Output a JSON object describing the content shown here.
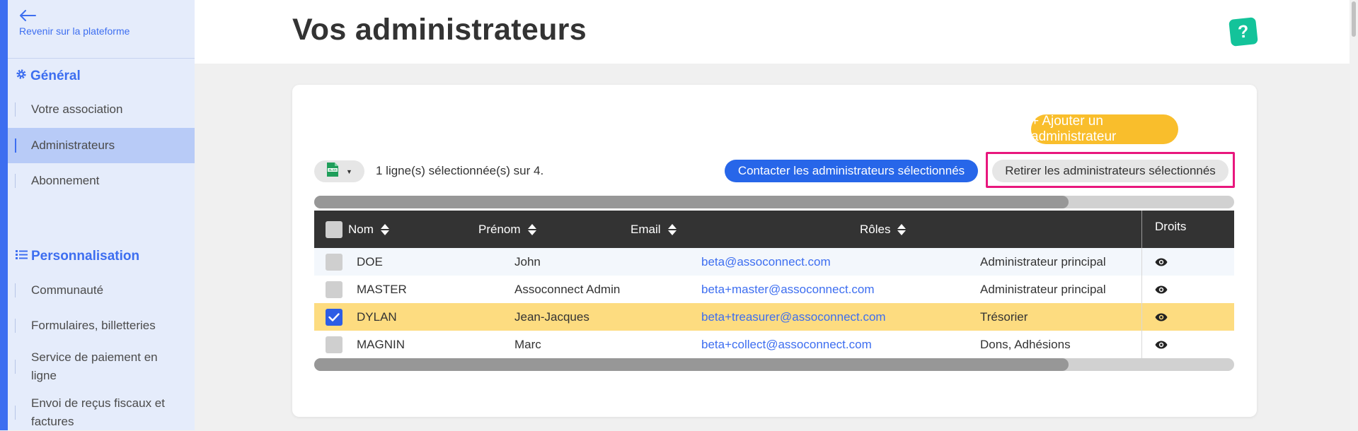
{
  "sidebar": {
    "back_label": "Revenir sur la plateforme",
    "general_title": "Général",
    "general_items": [
      "Votre association",
      "Administrateurs",
      "Abonnement"
    ],
    "active_item": "Administrateurs",
    "perso_title": "Personnalisation",
    "perso_items": [
      "Communauté",
      "Formulaires, billetteries",
      "Service de paiement en ligne",
      "Envoi de reçus fiscaux et factures"
    ]
  },
  "page": {
    "title": "Vos administrateurs",
    "help_label": "?"
  },
  "toolbar": {
    "add_button": "+ Ajouter un administrateur",
    "selection_text": "1 ligne(s) sélectionnée(s) sur 4.",
    "contact_button": "Contacter les administrateurs sélectionnés",
    "remove_button": "Retirer les administrateurs sélectionnés",
    "export_icon": "xlsx-file-icon"
  },
  "table": {
    "headers": {
      "nom": "Nom",
      "prenom": "Prénom",
      "email": "Email",
      "roles": "Rôles",
      "droits": "Droits"
    },
    "rows": [
      {
        "nom": "DOE",
        "prenom": "John",
        "email": "beta@assoconnect.com",
        "roles": "Administrateur principal",
        "selected": false
      },
      {
        "nom": "MASTER",
        "prenom": "Assoconnect Admin",
        "email": "beta+master@assoconnect.com",
        "roles": "Administrateur principal",
        "selected": false
      },
      {
        "nom": "DYLAN",
        "prenom": "Jean-Jacques",
        "email": "beta+treasurer@assoconnect.com",
        "roles": "Trésorier",
        "selected": true
      },
      {
        "nom": "MAGNIN",
        "prenom": "Marc",
        "email": "beta+collect@assoconnect.com",
        "roles": "Dons, Adhésions",
        "selected": false
      }
    ]
  },
  "colors": {
    "accent": "#3d6ef0",
    "add_button": "#f9be2c",
    "contact_button": "#2766e9",
    "highlight_frame": "#e8177d",
    "selected_row": "#fddc80",
    "help_button": "#13c39a",
    "header_bg": "#333333"
  }
}
